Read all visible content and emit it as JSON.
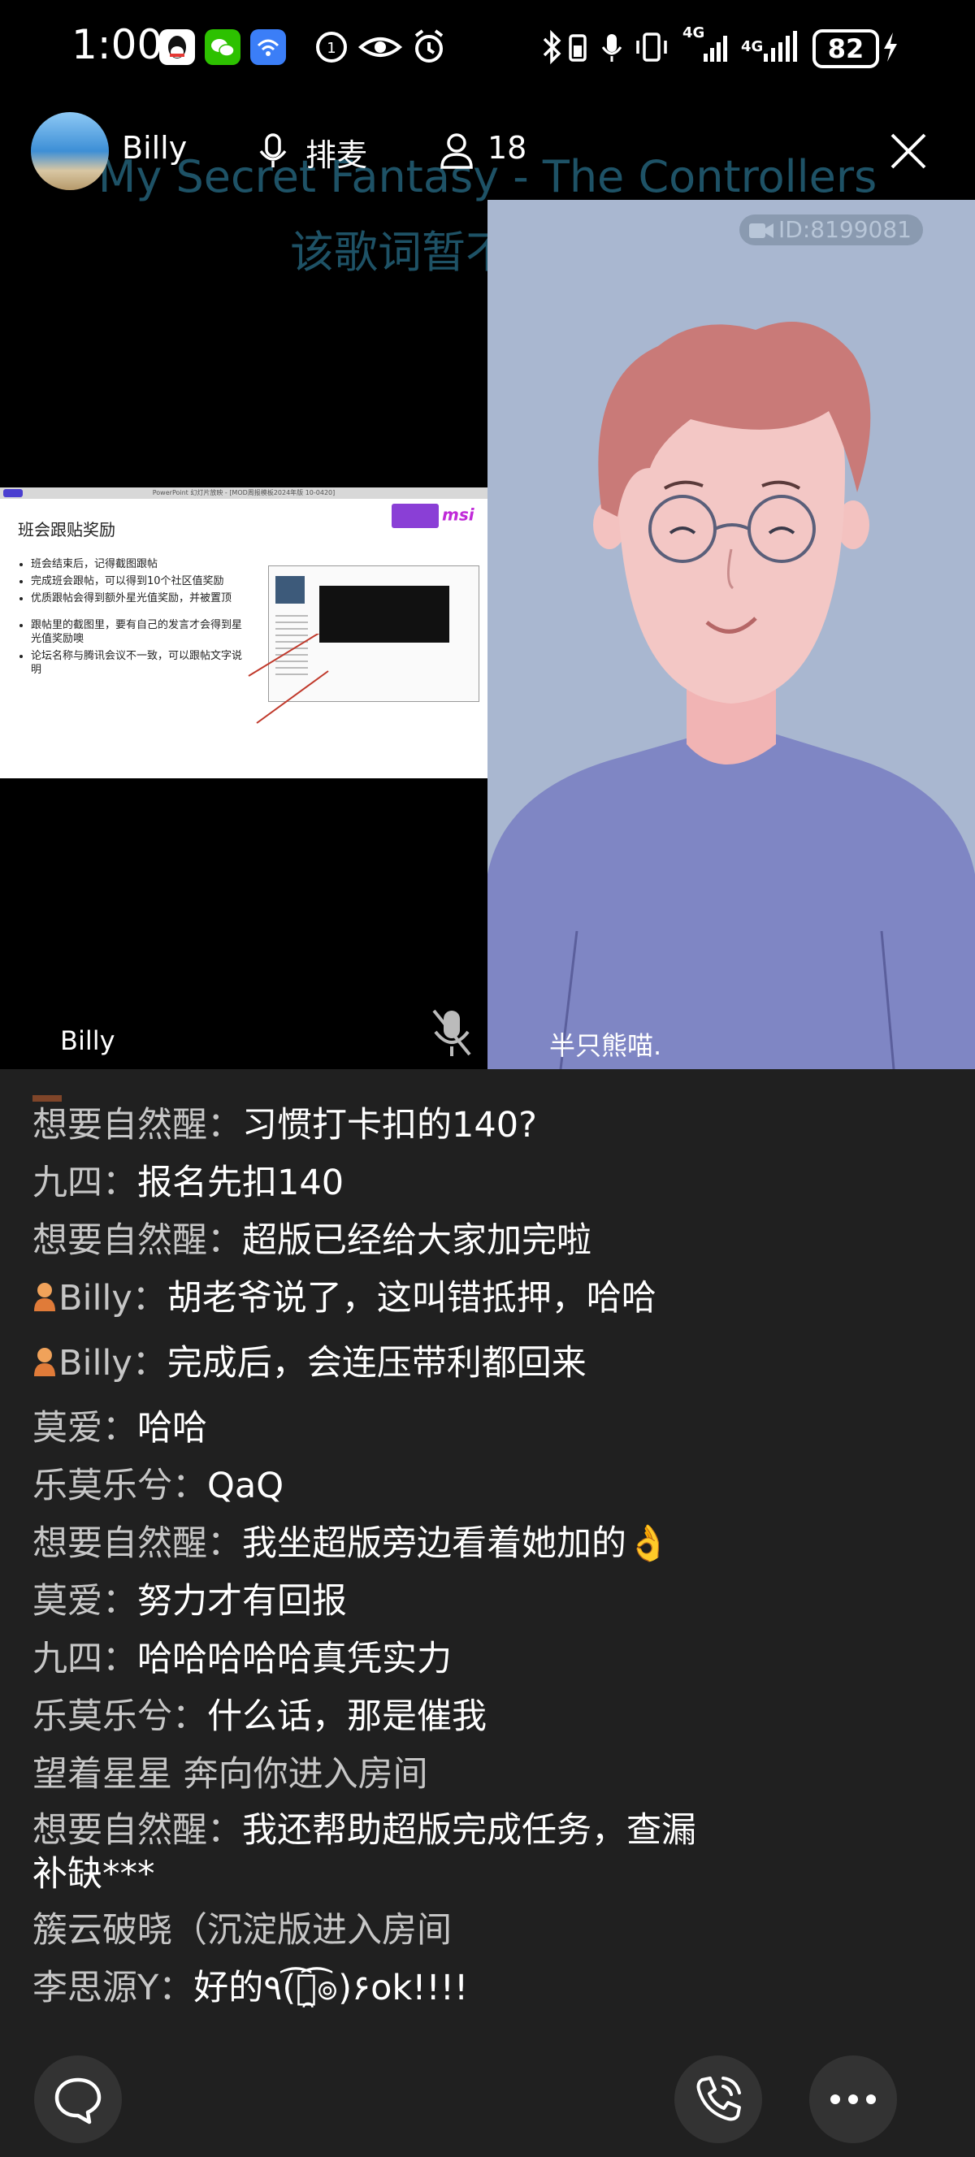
{
  "status_bar": {
    "time": "1:00",
    "signal1": "4G",
    "signal2": "4G",
    "battery": "82"
  },
  "header": {
    "host_name": "Billy",
    "queue_label": "排麦",
    "participant_count": "18"
  },
  "lyrics": {
    "line1": "My Secret Fantasy - The Controllers",
    "line2": "该歌词暂不支持滚动"
  },
  "shared_screen": {
    "window_title": "PowerPoint 幻灯片放映 - [MOD周报模板2024年版 10-0420]",
    "slide_title": "班会跟贴奖励",
    "logo_text": "msi",
    "bullets": [
      "班会结束后，记得截图跟帖",
      "完成班会跟帖，可以得到10个社区值奖励",
      "优质跟帖会得到额外星光值奖励，并被置顶",
      "跟帖里的截图里，要有自己的发言才会得到星光值奖励噢",
      "论坛名称与腾讯会议不一致，可以跟帖文字说明"
    ]
  },
  "video_tile": {
    "room_id": "ID:8199081",
    "participant_name": "半只熊喵."
  },
  "video_left_name": "Billy",
  "chat": {
    "messages": [
      {
        "sender": "想要自然醒：",
        "text": "习惯打卡扣的140?"
      },
      {
        "sender": "九四：",
        "text": "报名先扣140"
      },
      {
        "sender": "想要自然醒：",
        "text": "超版已经给大家加完啦"
      },
      {
        "sender": "Billy：",
        "text": "胡老爷说了，这叫错抵押，哈哈",
        "host": true
      },
      {
        "sender": "Billy：",
        "text": "完成后，会连压带利都回来",
        "host": true
      },
      {
        "sender": "莫爱：",
        "text": "哈哈"
      },
      {
        "sender": "乐莫乐兮：",
        "text": "QaQ"
      },
      {
        "sender": "想要自然醒：",
        "text": "我坐超版旁边看着她加的👌"
      },
      {
        "sender": "莫爱：",
        "text": "努力才有回报"
      },
      {
        "sender": "九四：",
        "text": "哈哈哈哈哈真凭实力"
      },
      {
        "sender": "乐莫乐兮：",
        "text": "什么话，那是催我"
      },
      {
        "sender": "",
        "text": "望着星星 奔向你进入房间",
        "system": true
      },
      {
        "sender": "想要自然醒：",
        "text": "我还帮助超版完成任务，查漏补缺***"
      },
      {
        "sender": "",
        "text": "簇云破晓（沉淀版进入房间",
        "system": true
      },
      {
        "sender": "李思源Y：",
        "text": "好的٩(͡๏̯͡๏)۶ok!!!!"
      }
    ]
  },
  "colors": {
    "background": "#202020",
    "video_bg": "#a9b7d0",
    "shirt": "#7f86c4",
    "hair": "#c97a78",
    "lyric": "#1e5266"
  }
}
